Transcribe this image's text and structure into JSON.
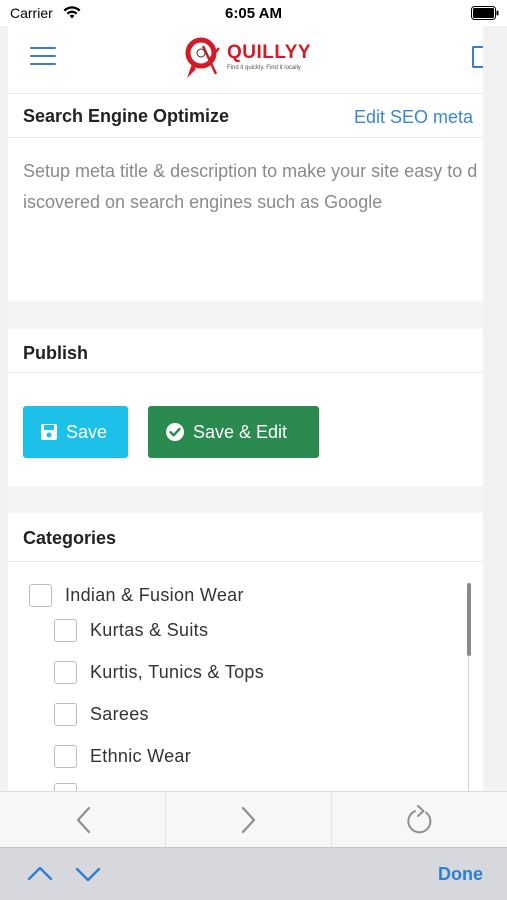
{
  "status_bar": {
    "carrier": "Carrier",
    "time": "6:05 AM"
  },
  "header": {
    "logo_text": "QUILLYY",
    "logo_tagline": "Find it quickly. Find it locally",
    "menu_icon": "hamburger-icon",
    "right_icon": "panel-icon"
  },
  "seo": {
    "title": "Search Engine Optimize",
    "edit_link": "Edit SEO meta",
    "description": "Setup meta title & description to make your site easy to discovered on search engines such as Google"
  },
  "publish": {
    "title": "Publish",
    "save_label": "Save",
    "save_edit_label": "Save & Edit",
    "save_icon": "floppy-disk-icon",
    "save_edit_icon": "check-circle-icon"
  },
  "categories": {
    "title": "Categories",
    "items": [
      {
        "label": "Indian & Fusion Wear",
        "level": 0,
        "checked": false
      },
      {
        "label": "Kurtas & Suits",
        "level": 1,
        "checked": false
      },
      {
        "label": "Kurtis, Tunics & Tops",
        "level": 1,
        "checked": false
      },
      {
        "label": "Sarees",
        "level": 1,
        "checked": false
      },
      {
        "label": "Ethnic Wear",
        "level": 1,
        "checked": false
      }
    ]
  },
  "browser_toolbar": {
    "back_icon": "chevron-left-icon",
    "forward_icon": "chevron-right-icon",
    "reload_icon": "reload-icon"
  },
  "keyboard_accessory": {
    "up_icon": "chevron-up-icon",
    "down_icon": "chevron-down-icon",
    "done_label": "Done"
  },
  "colors": {
    "accent": "#3a86d1",
    "save": "#1cc0e8",
    "save_edit": "#2b8a4f",
    "brand": "#d11b26"
  }
}
